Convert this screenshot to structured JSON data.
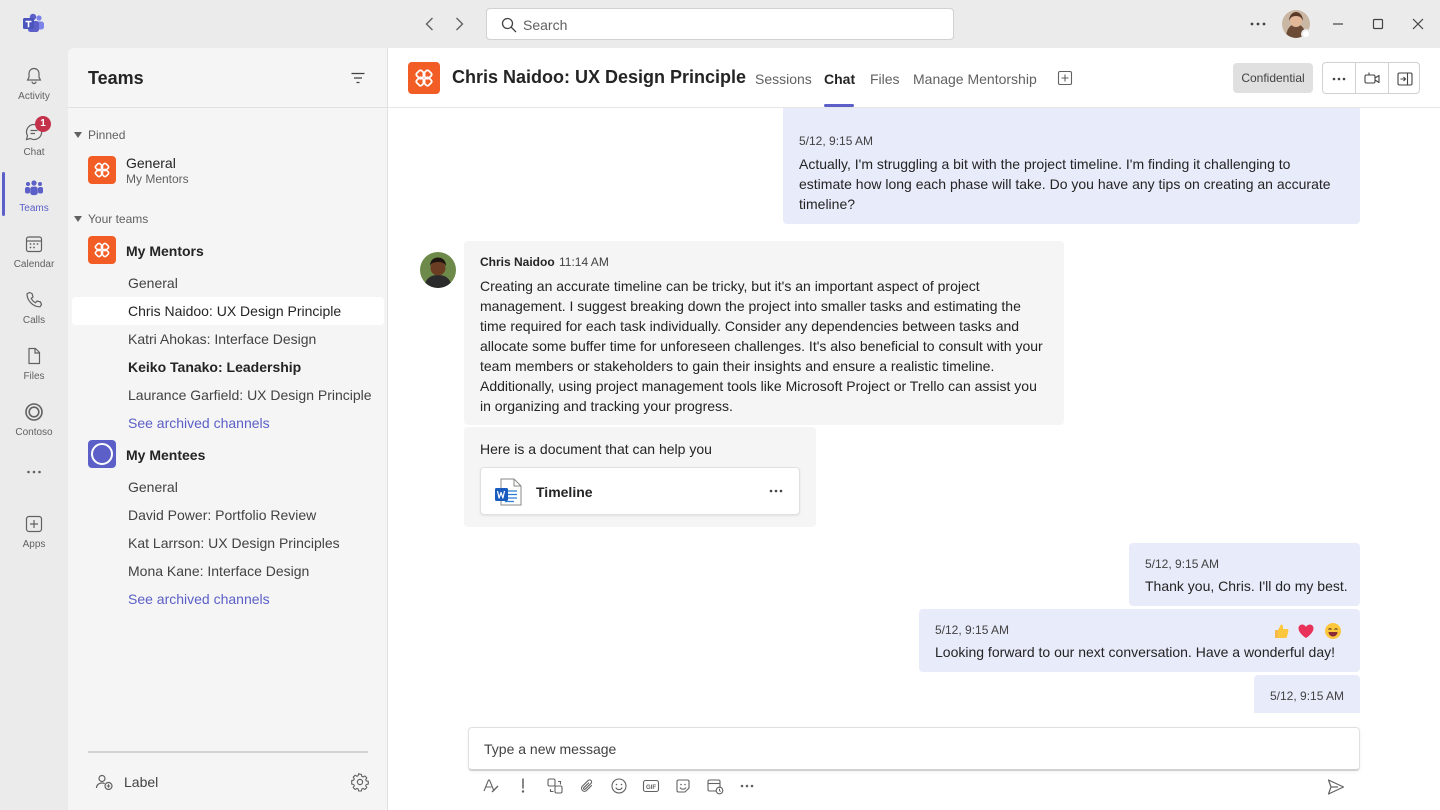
{
  "titlebar": {
    "search_placeholder": "Search",
    "icons": [
      "teams-logo-icon",
      "back-arrow-icon",
      "forward-arrow-icon",
      "search-icon",
      "more-icon",
      "minimize-icon",
      "maximize-icon",
      "close-icon"
    ]
  },
  "appbar": {
    "items": [
      {
        "label": "Activity",
        "icon": "bell-icon"
      },
      {
        "label": "Chat",
        "icon": "chat-icon",
        "badge": "1"
      },
      {
        "label": "Teams",
        "icon": "teams-icon",
        "active": true
      },
      {
        "label": "Calendar",
        "icon": "calendar-icon"
      },
      {
        "label": "Calls",
        "icon": "phone-icon"
      },
      {
        "label": "Files",
        "icon": "file-icon"
      },
      {
        "label": "Contoso",
        "icon": "contoso-icon"
      },
      {
        "label": "Apps",
        "icon": "add-apps-icon"
      }
    ],
    "accent": "#5b5fc7"
  },
  "leftpanel": {
    "title": "Teams",
    "pinned_header": "Pinned",
    "pinned": {
      "name": "General",
      "team": "My Mentors"
    },
    "your_teams_header": "Your teams",
    "teams": [
      {
        "name": "My Mentors",
        "channels": [
          {
            "label": "General"
          },
          {
            "label": "Chris Naidoo: UX Design Principle",
            "selected": true
          },
          {
            "label": "Katri Ahokas: Interface Design"
          },
          {
            "label": "Keiko Tanako: Leadership",
            "unread": true
          },
          {
            "label": "Laurance Garfield: UX Design Principle"
          },
          {
            "label": "See archived channels",
            "link": true
          }
        ]
      },
      {
        "name": "My Mentees",
        "channels": [
          {
            "label": "General"
          },
          {
            "label": "David Power: Portfolio Review"
          },
          {
            "label": "Kat Larrson: UX Design Principles"
          },
          {
            "label": "Mona Kane: Interface Design"
          },
          {
            "label": "See archived channels",
            "link": true
          }
        ]
      }
    ],
    "bottom_label": "Label"
  },
  "main": {
    "channel_title": "Chris Naidoo: UX Design Principle",
    "tabs": [
      "Sessions",
      "Chat",
      "Files",
      "Manage Mentorship"
    ],
    "active_tab": "Chat",
    "confidential": "Confidential",
    "messages": [
      {
        "from": "me",
        "time": "5/12, 9:15 AM",
        "text": "Actually, I'm struggling a bit with the project timeline. I'm finding it challenging to estimate how long each phase will take. Do you have any tips on creating an accurate timeline?"
      },
      {
        "from": "Chris Naidoo",
        "time": "11:14 AM",
        "text": "Creating an accurate timeline can be tricky, but it's an important aspect of project management. I suggest breaking down the project into smaller tasks and estimating the time required for each task individually. Consider any dependencies between tasks and allocate some buffer time for unforeseen challenges. It's also beneficial to consult with your team members or stakeholders to gain their insights and ensure a realistic timeline. Additionally, using project management tools like Microsoft Project or Trello can assist you in organizing and tracking your progress."
      },
      {
        "from": "Chris Naidoo",
        "text": "Here is a document that can help you",
        "attachment": {
          "name": "Timeline",
          "icon": "word-doc-icon"
        }
      },
      {
        "from": "me",
        "time": "5/12, 9:15 AM",
        "text": "Thank you, Chris. I'll do my best."
      },
      {
        "from": "me",
        "time": "5/12, 9:15 AM",
        "text": "Looking forward to our next conversation. Have a wonderful day!",
        "reactions": [
          "thumbs-up-icon",
          "heart-icon",
          "laugh-icon"
        ]
      },
      {
        "from": "me",
        "time": "5/12, 9:15 AM",
        "text": ""
      }
    ],
    "compose_placeholder": "Type a new message",
    "compose_tools": [
      "format-icon",
      "important-icon",
      "loop-icon",
      "attach-icon",
      "emoji-icon",
      "gif-icon",
      "sticker-icon",
      "schedule-meeting-icon",
      "more-icon",
      "send-icon"
    ]
  }
}
